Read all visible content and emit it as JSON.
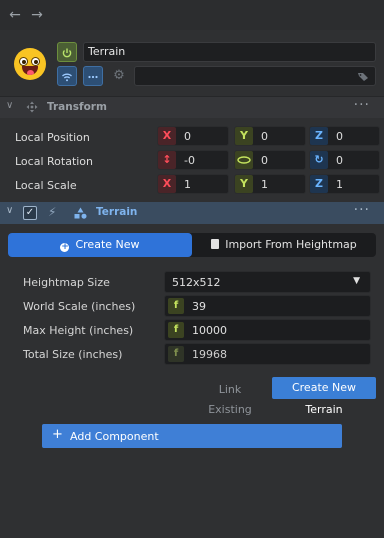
{
  "nav": {
    "back_icon": "←",
    "forward_icon": "→"
  },
  "object": {
    "name": "Terrain"
  },
  "transform": {
    "title": "Transform",
    "rows": [
      {
        "label": "Local Position",
        "x": "0",
        "y": "0",
        "z": "0"
      },
      {
        "label": "Local Rotation",
        "x": "-0",
        "y": "0",
        "z": "0"
      },
      {
        "label": "Local Scale",
        "x": "1",
        "y": "1",
        "z": "1"
      }
    ]
  },
  "terrain": {
    "title": "Terrain",
    "tabs": {
      "create_new": "Create New",
      "import": "Import From Heightmap"
    },
    "fields": {
      "heightmap_size_label": "Heightmap Size",
      "heightmap_size_value": "512x512",
      "world_scale_label": "World Scale (inches)",
      "world_scale_value": "39",
      "max_height_label": "Max Height (inches)",
      "max_height_value": "10000",
      "total_size_label": "Total Size (inches)",
      "total_size_value": "19968"
    },
    "link_existing": "Link Existing",
    "create_new_terrain": "Create New Terrain"
  },
  "add_component": "Add Component",
  "colors": {
    "accent": "#2f73d9",
    "axis_x": "#ff4d5a",
    "axis_y": "#c4e35e",
    "axis_z": "#6ab4ff"
  }
}
